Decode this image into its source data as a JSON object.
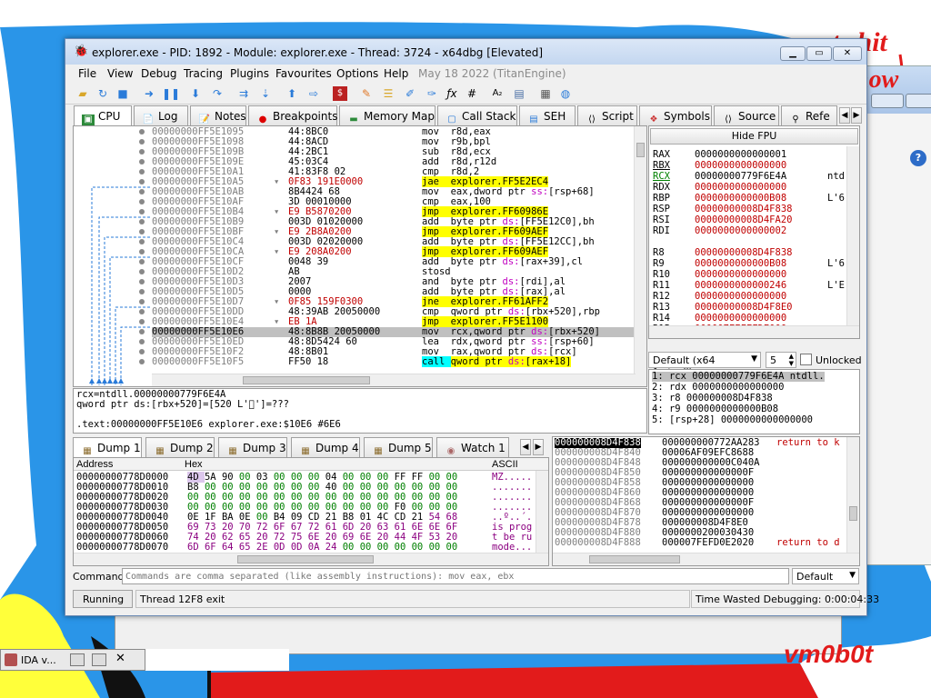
{
  "window": {
    "title": "explorer.exe - PID: 1892 - Module: explorer.exe - Thread: 3724 - x64dbg [Elevated]"
  },
  "menu": [
    "File",
    "View",
    "Debug",
    "Tracing",
    "Plugins",
    "Favourites",
    "Options",
    "Help"
  ],
  "menu_date": "May 18 2022 (TitanEngine)",
  "tabs": [
    "CPU",
    "Log",
    "Notes",
    "Breakpoints",
    "Memory Map",
    "Call Stack",
    "SEH",
    "Script",
    "Symbols",
    "Source",
    "Refe"
  ],
  "disasm": [
    {
      "addr": "00000000FF5E1095",
      "bytes": "44:8BC0",
      "instr": "mov r8d,eax"
    },
    {
      "addr": "00000000FF5E1098",
      "bytes": "44:8ACD",
      "instr": "mov r9b,bpl"
    },
    {
      "addr": "00000000FF5E109B",
      "bytes": "44:2BC1",
      "instr": "sub r8d,ecx"
    },
    {
      "addr": "00000000FF5E109E",
      "bytes": "45:03C4",
      "instr": "add r8d,r12d"
    },
    {
      "addr": "00000000FF5E10A1",
      "bytes": "41:83F8 02",
      "instr": "cmp r8d,2"
    },
    {
      "addr": "00000000FF5E10A5",
      "bytes": "0F83 191E0000",
      "instr": "jae explorer.FF5E2EC4"
    },
    {
      "addr": "00000000FF5E10AB",
      "bytes": "8B4424 68",
      "instr": "mov eax,dword ptr ss:[rsp+68]"
    },
    {
      "addr": "00000000FF5E10AF",
      "bytes": "3D 00010000",
      "instr": "cmp eax,100"
    },
    {
      "addr": "00000000FF5E10B4",
      "bytes": "E9 B5870200",
      "instr": "jmp explorer.FF60986E"
    },
    {
      "addr": "00000000FF5E10B9",
      "bytes": "003D 01020000",
      "instr": "add byte ptr ds:[FF5E12C0],bh"
    },
    {
      "addr": "00000000FF5E10BF",
      "bytes": "E9 2B8A0200",
      "instr": "jmp explorer.FF609AEF"
    },
    {
      "addr": "00000000FF5E10C4",
      "bytes": "003D 02020000",
      "instr": "add byte ptr ds:[FF5E12CC],bh"
    },
    {
      "addr": "00000000FF5E10CA",
      "bytes": "E9 208A0200",
      "instr": "jmp explorer.FF609AEF"
    },
    {
      "addr": "00000000FF5E10CF",
      "bytes": "0048 39",
      "instr": "add byte ptr ds:[rax+39],cl"
    },
    {
      "addr": "00000000FF5E10D2",
      "bytes": "AB",
      "instr": "stosd"
    },
    {
      "addr": "00000000FF5E10D3",
      "bytes": "2007",
      "instr": "and byte ptr ds:[rdi],al"
    },
    {
      "addr": "00000000FF5E10D5",
      "bytes": "0000",
      "instr": "add byte ptr ds:[rax],al"
    },
    {
      "addr": "00000000FF5E10D7",
      "bytes": "0F85 159F0300",
      "instr": "jne explorer.FF61AFF2"
    },
    {
      "addr": "00000000FF5E10DD",
      "bytes": "48:39AB 20050000",
      "instr": "cmp qword ptr ds:[rbx+520],rbp"
    },
    {
      "addr": "00000000FF5E10E4",
      "bytes": "EB 1A",
      "instr": "jmp explorer.FF5E1100"
    },
    {
      "addr": "00000000FF5E10E6",
      "bytes": "48:8B8B 20050000",
      "instr": "mov rcx,qword ptr ds:[rbx+520]"
    },
    {
      "addr": "00000000FF5E10ED",
      "bytes": "48:8D5424 60",
      "instr": "lea rdx,qword ptr ss:[rsp+60]"
    },
    {
      "addr": "00000000FF5E10F2",
      "bytes": "48:8B01",
      "instr": "mov rax,qword ptr ds:[rcx]"
    },
    {
      "addr": "00000000FF5E10F5",
      "bytes": "FF50 18",
      "instr": "call qword ptr ds:[rax+18]"
    }
  ],
  "info_lines": [
    "rcx=ntdll.00000000779F6E4A",
    "qword ptr ds:[rbx+520]=[520 L'\u0000']=???",
    ".text:00000000FF5E10E6 explorer.exe:$10E6 #6E6"
  ],
  "hide_fpu": "Hide FPU",
  "registers": [
    {
      "name": "RAX",
      "val": "0000000000000001",
      "extra": ""
    },
    {
      "name": "RBX",
      "val": "0000000000000000",
      "extra": ""
    },
    {
      "name": "RCX",
      "val": "00000000779F6E4A",
      "extra": "ntd"
    },
    {
      "name": "RDX",
      "val": "0000000000000000",
      "extra": ""
    },
    {
      "name": "RBP",
      "val": "0000000000000B08",
      "extra": "L'6"
    },
    {
      "name": "RSP",
      "val": "00000000008D4F838",
      "extra": ""
    },
    {
      "name": "RSI",
      "val": "00000000008D4FA20",
      "extra": ""
    },
    {
      "name": "RDI",
      "val": "0000000000000002",
      "extra": ""
    },
    {
      "name": "R8",
      "val": "00000000008D4F838",
      "extra": ""
    },
    {
      "name": "R9",
      "val": "0000000000000B08",
      "extra": "L'6"
    },
    {
      "name": "R10",
      "val": "0000000000000000",
      "extra": ""
    },
    {
      "name": "R11",
      "val": "0000000000000246",
      "extra": "L'E"
    },
    {
      "name": "R12",
      "val": "0000000000000000",
      "extra": ""
    },
    {
      "name": "R13",
      "val": "00000000008D4F8E0",
      "extra": ""
    },
    {
      "name": "R14",
      "val": "0000000000000000",
      "extra": ""
    },
    {
      "name": "R15",
      "val": "000007FEFFFDE000",
      "extra": ""
    }
  ],
  "callconv": {
    "selected": "Default (x64 fastcall)",
    "count": "5",
    "unlocked": "Unlocked"
  },
  "args": [
    "1: rcx 00000000779F6E4A ntdll.",
    "2: rdx 0000000000000000",
    "3: r8 000000008D4F838",
    "4: r9 0000000000000B08",
    "5: [rsp+28] 0000000000000000"
  ],
  "dump_tabs": [
    "Dump 1",
    "Dump 2",
    "Dump 3",
    "Dump 4",
    "Dump 5",
    "Watch 1"
  ],
  "dump_headers": {
    "address": "Address",
    "hex": "Hex",
    "ascii": "ASCII"
  },
  "dump": [
    {
      "addr": "00000000778D0000",
      "hex": "4D 5A 90 00 03 00 00 00 04 00 00 00 FF FF 00 00",
      "ascii": "MZ.........ÿÿ.."
    },
    {
      "addr": "00000000778D0010",
      "hex": "B8 00 00 00 00 00 00 00 40 00 00 00 00 00 00 00",
      "ascii": "........@......."
    },
    {
      "addr": "00000000778D0020",
      "hex": "00 00 00 00 00 00 00 00 00 00 00 00 00 00 00 00",
      "ascii": "................"
    },
    {
      "addr": "00000000778D0030",
      "hex": "00 00 00 00 00 00 00 00 00 00 00 00 F0 00 00 00",
      "ascii": "............ð..."
    },
    {
      "addr": "00000000778D0040",
      "hex": "0E 1F BA 0E 00 B4 09 CD 21 B8 01 4C CD 21 54 68",
      "ascii": "..º..´.Í!¸.LÍ!Th"
    },
    {
      "addr": "00000000778D0050",
      "hex": "69 73 20 70 72 6F 67 72 61 6D 20 63 61 6E 6E 6F",
      "ascii": "is program canno"
    },
    {
      "addr": "00000000778D0060",
      "hex": "74 20 62 65 20 72 75 6E 20 69 6E 20 44 4F 53 20",
      "ascii": "t be run in DOS "
    },
    {
      "addr": "00000000778D0070",
      "hex": "6D 6F 64 65 2E 0D 0D 0A 24 00 00 00 00 00 00 00",
      "ascii": "mode....$......."
    }
  ],
  "stack": [
    {
      "addr": "000000008D4F838",
      "val": "000000000772AA283",
      "comment": "return to k"
    },
    {
      "addr": "000000008D4F840",
      "val": "00006AF09EFC8688",
      "comment": ""
    },
    {
      "addr": "000000008D4F848",
      "val": "000000000000C040A",
      "comment": ""
    },
    {
      "addr": "000000008D4F850",
      "val": "000000000000000F",
      "comment": ""
    },
    {
      "addr": "000000008D4F858",
      "val": "0000000000000000",
      "comment": ""
    },
    {
      "addr": "000000008D4F860",
      "val": "0000000000000000",
      "comment": ""
    },
    {
      "addr": "000000008D4F868",
      "val": "000000000000000F",
      "comment": ""
    },
    {
      "addr": "000000008D4F870",
      "val": "0000000000000000",
      "comment": ""
    },
    {
      "addr": "000000008D4F878",
      "val": "000000008D4F8E0",
      "comment": ""
    },
    {
      "addr": "000000008D4F880",
      "val": "0000000200030430",
      "comment": ""
    },
    {
      "addr": "000000008D4F888",
      "val": "000007FEFD0E2020",
      "comment": "return to d"
    }
  ],
  "command": {
    "label": "Command:",
    "placeholder": "Commands are comma separated (like assembly instructions): mov eax, ebx",
    "mode": "Default"
  },
  "status": {
    "state": "Running",
    "message": "Thread 12F8 exit",
    "time": "Time Wasted Debugging: 0:00:04:33"
  },
  "background": {
    "graffiti_top": "t shit",
    "graffiti_2": "how",
    "signature": "vm0b0t",
    "taskbar_ida": "IDA v..."
  },
  "colors": {
    "accent_yellow": "#ffff00",
    "reg_changed": "#c00000",
    "selection": "#c0c0c0"
  }
}
